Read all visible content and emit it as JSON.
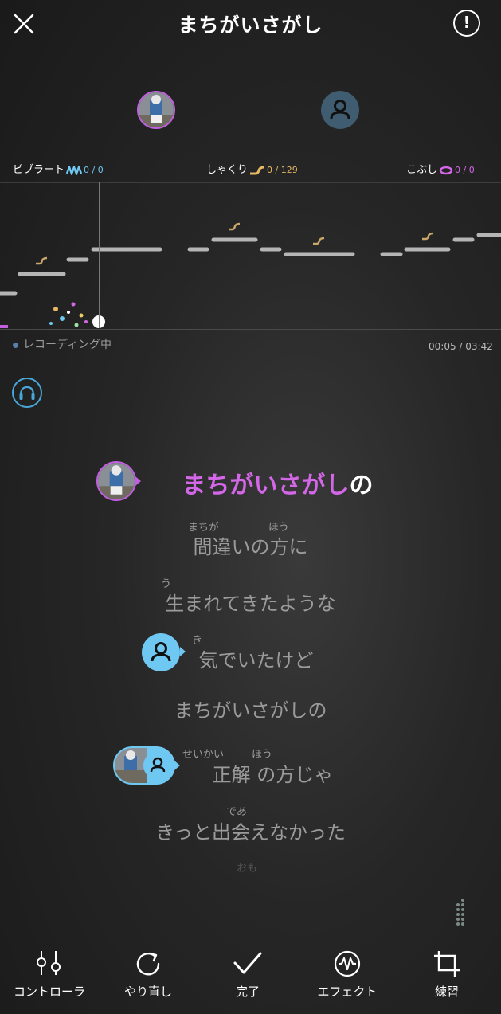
{
  "header": {
    "title": "まちがいさがし",
    "close_icon": "close-icon",
    "info_icon": "info-icon"
  },
  "stats": {
    "vibrato": {
      "label": "ビブラート",
      "score": "0",
      "total": "0"
    },
    "shakuri": {
      "label": "しゃくり",
      "score": "0",
      "total": "129"
    },
    "kobushi": {
      "label": "こぶし",
      "score": "0",
      "total": "0"
    }
  },
  "recording": {
    "status": "レコーディング中",
    "elapsed": "00:05",
    "total": "03:42",
    "separator": " / "
  },
  "lyrics": {
    "line1_sung": "まちがいさがし",
    "line1_rest": "の",
    "line2": "間違いの方に",
    "line2_ruby1": "まちが",
    "line2_ruby2": "ほう",
    "line3": "生まれてきたような",
    "line3_ruby": "う",
    "line4": "気でいたけど",
    "line4_ruby": "き",
    "line5": "まちがいさがしの",
    "line6": "正解 の方じゃ",
    "line6_ruby1": "せいかい",
    "line6_ruby2": "ほう",
    "line7": "きっと出会えなかった",
    "line7_ruby": "であ",
    "line8_ruby": "おも"
  },
  "nav": {
    "controller": "コントローラ",
    "redo": "やり直し",
    "done": "完了",
    "effect": "エフェクト",
    "practice": "練習"
  },
  "colors": {
    "accent_purple": "#c25fe0",
    "accent_blue": "#6fc8f2",
    "shakuri_gold": "#e8b864"
  }
}
